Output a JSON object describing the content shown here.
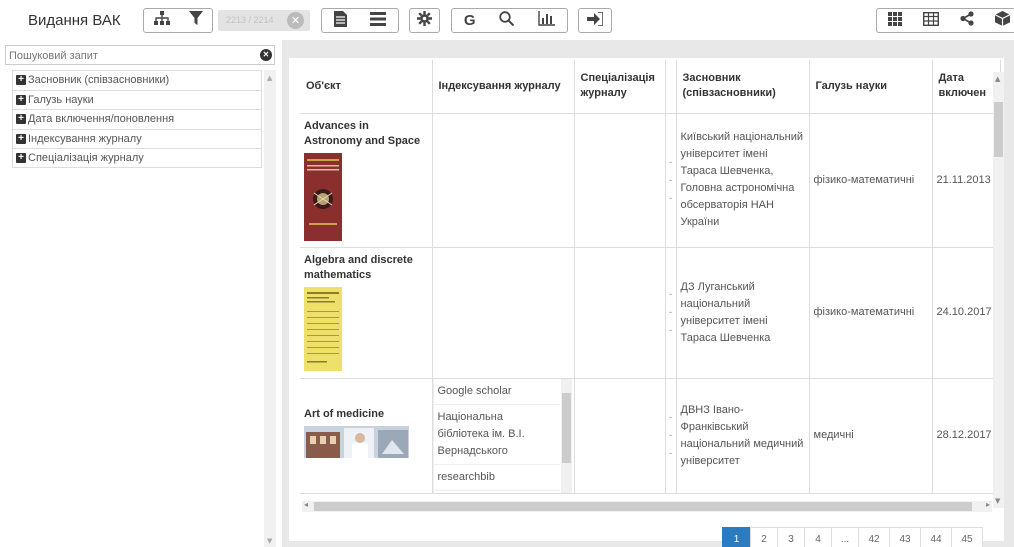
{
  "app": {
    "title": "Видання ВАК",
    "counter": "2213 / 2214"
  },
  "toolbar": {
    "group1": [
      "hierarchy-icon",
      "filter-icon"
    ],
    "group2": [
      "document-icon",
      "list-icon"
    ],
    "group3": [
      "gear-icon"
    ],
    "group4": {
      "g_label": "G",
      "icons": [
        "search-icon",
        "bar-chart-icon"
      ]
    },
    "group5": [
      "export-icon"
    ],
    "right": [
      "tiles-icon",
      "table-icon",
      "share-icon",
      "cube-icon"
    ]
  },
  "search": {
    "placeholder": "Пошуковий запит"
  },
  "facets": [
    {
      "label": "Засновник (співзасновники)"
    },
    {
      "label": "Галузь науки"
    },
    {
      "label": "Дата включення/поновлення"
    },
    {
      "label": "Індексування журналу"
    },
    {
      "label": "Спеціалізація журналу"
    }
  ],
  "table": {
    "headers": {
      "object": "Об'єкт",
      "indexing": "Індексування журналу",
      "specialization": "Спеціалізація журналу",
      "founder": "Засновник (співзасновники)",
      "field": "Галузь науки",
      "date": "Дата включен"
    },
    "rows": [
      {
        "title": "Advances in Astronomy and Space",
        "cover_colors": {
          "bg": "#8b2e2e",
          "accent": "#c9a34a"
        },
        "indexing": [],
        "specialization": "",
        "founder": "Київський національний університет імені Тараса Шевченка, Головна астрономічна обсерваторія НАН України",
        "field": "фізико-математичні",
        "date": "21.11.2013"
      },
      {
        "title": "Algebra and discrete mathematics",
        "cover_colors": {
          "bg": "#efe06a",
          "accent": "#8a7d2a"
        },
        "indexing": [],
        "specialization": "",
        "founder": "ДЗ Луганський національний університет імені Тараса Шевченка",
        "field": "фізико-математичні",
        "date": "24.10.2017"
      },
      {
        "title": "Art of medicine",
        "cover_colors": {
          "bg": "#c8d2de",
          "accent": "#7a5040"
        },
        "indexing": [
          "Google scholar",
          "Національна бібліотека ім. В.І. Вернадського",
          "researchbib"
        ],
        "specialization": "",
        "founder": "ДВНЗ Івано-Франківський національний медичний університет",
        "field": "медичні",
        "date": "28.12.2017"
      }
    ]
  },
  "pagination": [
    "1",
    "2",
    "3",
    "4",
    "...",
    "42",
    "43",
    "44",
    "45"
  ],
  "pagination_active": "1",
  "colors": {
    "accent": "#2a7bbf",
    "panel_bg": "#e8e8e8"
  }
}
